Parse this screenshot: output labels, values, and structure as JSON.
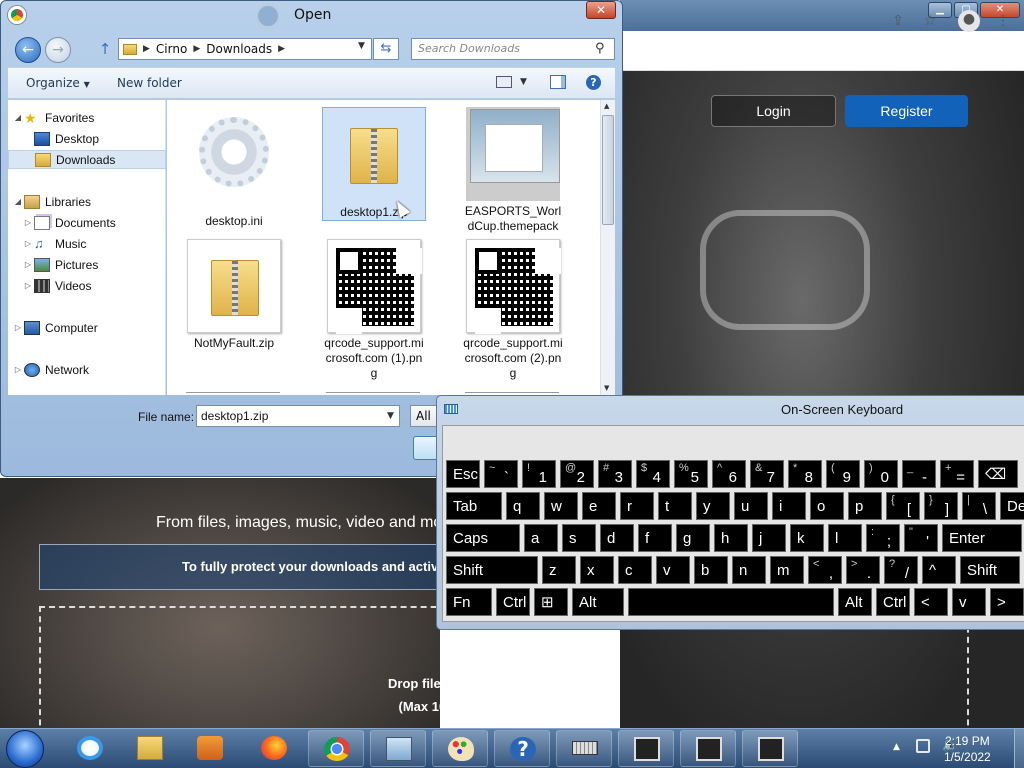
{
  "browser": {
    "login_label": "Login",
    "register_label": "Register",
    "upload_subtitle": "From files, images, music, video and more",
    "protect_banner": "To fully protect your downloads and activities",
    "drop_line1": "Drop files here or click to upload files",
    "drop_line2": "(Max 10 files at once, 5GB per file)"
  },
  "dialog": {
    "title": "Open",
    "breadcrumb": [
      "Cirno",
      "Downloads"
    ],
    "search_placeholder": "Search Downloads",
    "organize_label": "Organize",
    "new_folder_label": "New folder",
    "nav": [
      {
        "label": "Favorites",
        "icon": "star-icon"
      },
      {
        "label": "Desktop",
        "icon": "desktop-icon"
      },
      {
        "label": "Downloads",
        "icon": "folder-icon",
        "selected": true
      },
      {
        "label": "Libraries",
        "icon": "libraries-icon"
      },
      {
        "label": "Documents",
        "icon": "documents-icon"
      },
      {
        "label": "Music",
        "icon": "music-icon"
      },
      {
        "label": "Pictures",
        "icon": "pictures-icon"
      },
      {
        "label": "Videos",
        "icon": "videos-icon"
      },
      {
        "label": "Computer",
        "icon": "computer-icon"
      },
      {
        "label": "Network",
        "icon": "network-icon"
      }
    ],
    "files": [
      {
        "name": "desktop.ini",
        "type": "settings"
      },
      {
        "name": "desktop1.zip",
        "type": "zip",
        "selected": true
      },
      {
        "name": "EASPORTS_WorldCup.themepack",
        "type": "themepack"
      },
      {
        "name": "NotMyFault.zip",
        "type": "zip"
      },
      {
        "name": "qrcode_support.microsoft.com (1).png",
        "type": "qr"
      },
      {
        "name": "qrcode_support.microsoft.com (2).png",
        "type": "qr"
      }
    ],
    "file_name_label": "File name:",
    "file_name_value": "desktop1.zip",
    "file_type_value": "All"
  },
  "osk": {
    "title": "On-Screen Keyboard",
    "row1": [
      {
        "m": "Esc"
      },
      {
        "s": "~",
        "l": "`"
      },
      {
        "s": "!",
        "l": "1"
      },
      {
        "s": "@",
        "l": "2"
      },
      {
        "s": "#",
        "l": "3"
      },
      {
        "s": "$",
        "l": "4"
      },
      {
        "s": "%",
        "l": "5"
      },
      {
        "s": "^",
        "l": "6"
      },
      {
        "s": "&",
        "l": "7"
      },
      {
        "s": "*",
        "l": "8"
      },
      {
        "s": "(",
        "l": "9"
      },
      {
        "s": ")",
        "l": "0"
      },
      {
        "s": "_",
        "l": "-"
      },
      {
        "s": "+",
        "l": "="
      },
      {
        "m": "⌫"
      }
    ],
    "row2": [
      {
        "m": "Tab"
      },
      {
        "m": "q"
      },
      {
        "m": "w"
      },
      {
        "m": "e"
      },
      {
        "m": "r"
      },
      {
        "m": "t"
      },
      {
        "m": "y"
      },
      {
        "m": "u"
      },
      {
        "m": "i"
      },
      {
        "m": "o"
      },
      {
        "m": "p"
      },
      {
        "s": "{",
        "l": "["
      },
      {
        "s": "}",
        "l": "]"
      },
      {
        "s": "|",
        "l": "\\"
      },
      {
        "m": "Del"
      }
    ],
    "row3": [
      {
        "m": "Caps"
      },
      {
        "m": "a"
      },
      {
        "m": "s"
      },
      {
        "m": "d"
      },
      {
        "m": "f"
      },
      {
        "m": "g"
      },
      {
        "m": "h"
      },
      {
        "m": "j"
      },
      {
        "m": "k"
      },
      {
        "m": "l"
      },
      {
        "s": ":",
        "l": ";"
      },
      {
        "s": "\"",
        "l": "'"
      },
      {
        "m": "Enter"
      }
    ],
    "row4": [
      {
        "m": "Shift"
      },
      {
        "m": "z"
      },
      {
        "m": "x"
      },
      {
        "m": "c"
      },
      {
        "m": "v"
      },
      {
        "m": "b"
      },
      {
        "m": "n"
      },
      {
        "m": "m"
      },
      {
        "s": "<",
        "l": ","
      },
      {
        "s": ">",
        "l": "."
      },
      {
        "s": "?",
        "l": "/"
      },
      {
        "m": "^"
      },
      {
        "m": "Shift"
      }
    ],
    "row5": [
      {
        "m": "Fn"
      },
      {
        "m": "Ctrl"
      },
      {
        "m": "⊞"
      },
      {
        "m": "Alt"
      },
      {
        "m": ""
      },
      {
        "m": "Alt"
      },
      {
        "m": "Ctrl"
      },
      {
        "m": "<"
      },
      {
        "m": "v"
      },
      {
        "m": ">"
      },
      {
        "m": "▤"
      }
    ]
  },
  "taskbar": {
    "time": "2:19 PM",
    "date": "1/5/2022"
  }
}
